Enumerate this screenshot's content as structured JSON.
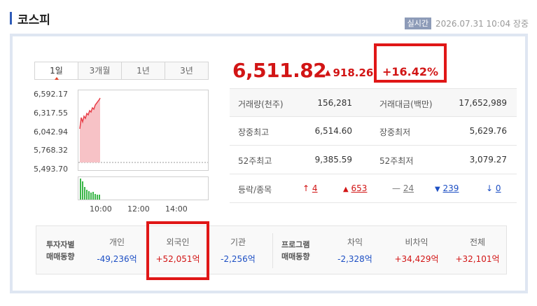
{
  "header": {
    "title": "코스피",
    "badge": "실시간",
    "timestamp": "2026.07.31 10:04 장중"
  },
  "tabs": [
    {
      "label": "1일",
      "active": true
    },
    {
      "label": "3개월",
      "active": false
    },
    {
      "label": "1년",
      "active": false
    },
    {
      "label": "3년",
      "active": false
    }
  ],
  "chart": {
    "y_ticks": [
      "6,592.17",
      "6,317.55",
      "6,042.94",
      "5,768.32",
      "5,493.70"
    ],
    "x_ticks": [
      "10:00",
      "12:00",
      "14:00"
    ],
    "series_color": "#e8404a",
    "fill_color": "#f7c2c6",
    "volume_color": "#3cb64a"
  },
  "quote": {
    "price": "6,511.82",
    "change_arrow": "▲",
    "change": "918.26",
    "change_pct": "+16.42%",
    "up_color": "#d21515"
  },
  "stats": [
    [
      {
        "label": "거래량(천주)",
        "value": "156,281"
      },
      {
        "label": "거래대금(백만)",
        "value": "17,652,989"
      }
    ],
    [
      {
        "label": "장중최고",
        "value": "6,514.60"
      },
      {
        "label": "장중최저",
        "value": "5,629.76"
      }
    ],
    [
      {
        "label": "52주최고",
        "value": "9,385.59"
      },
      {
        "label": "52주최저",
        "value": "3,079.27"
      }
    ]
  ],
  "breadth": {
    "label": "등락/종목",
    "upper_limit": {
      "arrow": "↑",
      "value": "4"
    },
    "up": {
      "arrow": "▲",
      "value": "653"
    },
    "flat": {
      "arrow": "—",
      "value": "24"
    },
    "down": {
      "arrow": "▼",
      "value": "239"
    },
    "lower_limit": {
      "arrow": "↓",
      "value": "0"
    }
  },
  "investors": {
    "label_1": "투자자별",
    "label_2": "매매동향",
    "cols": [
      {
        "header": "개인",
        "value": "-49,236억",
        "sign": "down"
      },
      {
        "header": "외국인",
        "value": "+52,051억",
        "sign": "up"
      },
      {
        "header": "기관",
        "value": "-2,256억",
        "sign": "down"
      }
    ]
  },
  "program": {
    "label_1": "프로그램",
    "label_2": "매매동향",
    "cols": [
      {
        "header": "차익",
        "value": "-2,328억",
        "sign": "down"
      },
      {
        "header": "비차익",
        "value": "+34,429억",
        "sign": "up"
      },
      {
        "header": "전체",
        "value": "+32,101억",
        "sign": "up"
      }
    ]
  }
}
